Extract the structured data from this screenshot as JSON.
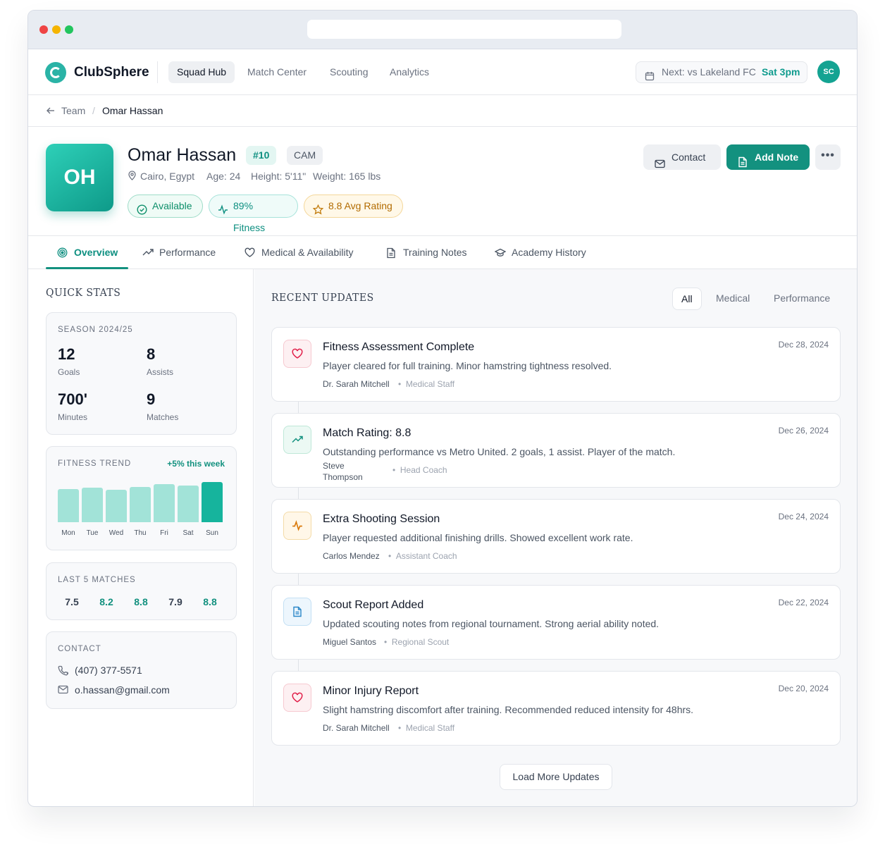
{
  "app": {
    "name": "ClubSphere"
  },
  "nav": {
    "items": [
      "Squad Hub",
      "Match Center",
      "Scouting",
      "Analytics"
    ],
    "active": "Squad Hub",
    "next_match_label": "Next: vs Lakeland FC",
    "next_match_time": "Sat 3pm",
    "user_initials": "SC"
  },
  "breadcrumb": {
    "parent": "Team",
    "separator": "/",
    "current": "Omar Hassan"
  },
  "player": {
    "initials": "OH",
    "name": "Omar Hassan",
    "number": "#10",
    "position": "CAM",
    "location": "Cairo, Egypt",
    "age": "Age: 24",
    "height": "Height: 5'11\"",
    "weight": "Weight: 165 lbs",
    "badges": {
      "status": "Available",
      "fitness": "89% Fitness",
      "rating": "8.8 Avg Rating"
    }
  },
  "actions": {
    "contact": "Contact",
    "add_note": "Add Note",
    "more": "•••"
  },
  "tabs": [
    "Overview",
    "Performance",
    "Medical & Availability",
    "Training Notes",
    "Academy History"
  ],
  "quick_stats": {
    "title": "QUICK STATS",
    "season": {
      "caption": "SEASON 2024/25",
      "goals": "12",
      "goals_label": "Goals",
      "assists": "8",
      "assists_label": "Assists",
      "minutes": "700'",
      "minutes_label": "Minutes",
      "matches": "9",
      "matches_label": "Matches"
    },
    "fitness_trend": {
      "caption": "FITNESS TREND",
      "change": "+5% this week",
      "days": [
        "Mon",
        "Tue",
        "Wed",
        "Thu",
        "Fri",
        "Sat",
        "Sun"
      ],
      "values": [
        83,
        86,
        81,
        88,
        95,
        92,
        100
      ],
      "highlight_color": "#16b49d",
      "bar_color": "#a2e3d8"
    },
    "last_matches": {
      "caption": "LAST 5 MATCHES",
      "scores": [
        "7.5",
        "8.2",
        "8.8",
        "7.9",
        "8.8"
      ],
      "highlight": [
        false,
        true,
        true,
        false,
        true
      ]
    },
    "contact": {
      "caption": "CONTACT",
      "phone": "(407) 377-5571",
      "email": "o.hassan@gmail.com"
    }
  },
  "updates": {
    "title": "RECENT UPDATES",
    "filters": [
      "All",
      "Medical",
      "Performance"
    ],
    "active_filter": "All",
    "items": [
      {
        "icon": "heart-icon",
        "title": "Fitness Assessment Complete",
        "desc": "Player cleared for full training. Minor hamstring tightness resolved.",
        "author": "Dr. Sarah Mitchell",
        "role": "Medical Staff",
        "date": "Dec 28, 2024"
      },
      {
        "icon": "trending-up-icon",
        "title": "Match Rating: 8.8",
        "desc": "Outstanding performance vs Metro United. 2 goals, 1 assist. Player of the match.",
        "author": "Steve Thompson",
        "role": "Head Coach",
        "date": "Dec 26, 2024"
      },
      {
        "icon": "activity-icon",
        "title": "Extra Shooting Session",
        "desc": "Player requested additional finishing drills. Showed excellent work rate.",
        "author": "Carlos Mendez",
        "role": "Assistant Coach",
        "date": "Dec 24, 2024"
      },
      {
        "icon": "document-icon",
        "title": "Scout Report Added",
        "desc": "Updated scouting notes from regional tournament. Strong aerial ability noted.",
        "author": "Miguel Santos",
        "role": "Regional Scout",
        "date": "Dec 22, 2024"
      },
      {
        "icon": "heart-icon",
        "title": "Minor Injury Report",
        "desc": "Slight hamstring discomfort after training. Recommended reduced intensity for 48hrs.",
        "author": "Dr. Sarah Mitchell",
        "role": "Medical Staff",
        "date": "Dec 20, 2024"
      }
    ],
    "load_more": "Load More Updates"
  }
}
